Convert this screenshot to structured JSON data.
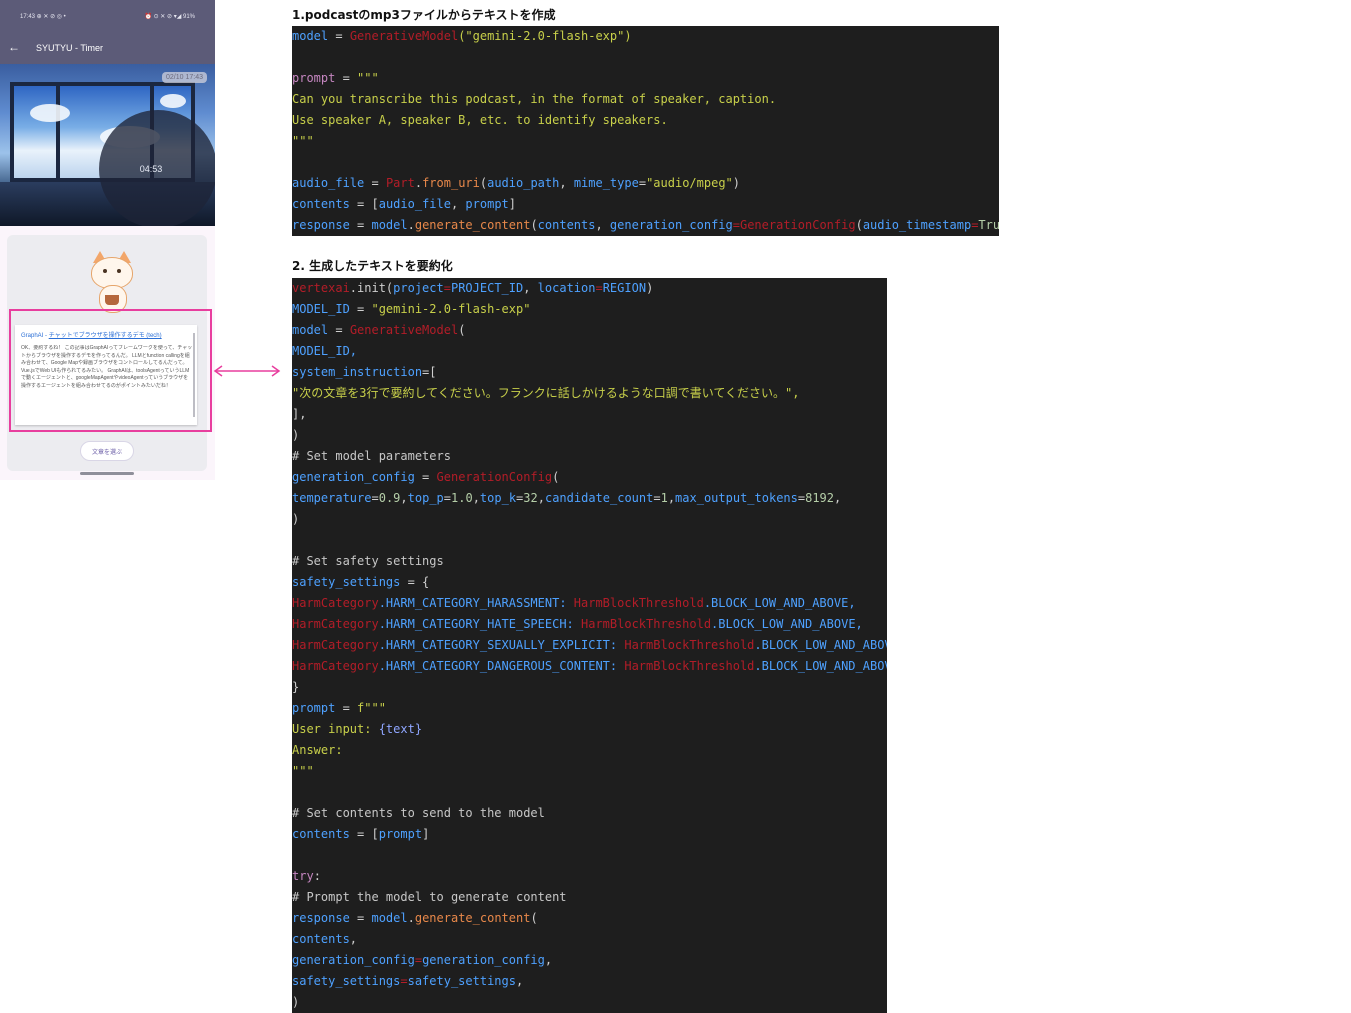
{
  "phone": {
    "status_left": "17:43 ⊕ ✕ ⊘ ◎ •",
    "status_right": "⏰ ⊙ ✕ ⊘ ▾◢ 91%",
    "app_title": "SYUTYU - Timer",
    "back_icon": "←",
    "timestamp_badge": "02/10 17:43",
    "timer": "04:53",
    "card_prefix": "GraphAI - ",
    "card_link": "チャットでブラウザを操作するデモ (tech)",
    "card_body": "OK、要約するね！ この記事はGraphAIってフレームワークを使って、チャットからブラウザを操作するデモを作ってるんだ。 LLMとfunction callingを組み合わせて、Google Mapや録画ブラウザをコントロールしてるんだって。Vue.jsでWeb UIも作られてるみたい。 GraphAIは、toolsAgentっていうLLMで動くエージェントと、googleMapAgentやvideoAgentっていうブラウザを操作するエージェントを組み合わせてるのがポイントみたいだね！",
    "pill_label": "文章を選ぶ"
  },
  "sections": [
    {
      "title": "1.podcastのmp3ファイルからテキストを作成"
    },
    {
      "title": "2. 生成したテキストを要約化"
    }
  ],
  "code1": {
    "l1": [
      "model",
      " = ",
      "GenerativeModel",
      "(\"gemini-2.0-flash-exp\")"
    ],
    "l3": [
      "prompt",
      " = ",
      "\"\"\""
    ],
    "l4": "Can you transcribe this podcast, in the format of speaker, caption.",
    "l5": "Use speaker A, speaker B, etc. to identify speakers.",
    "l6": "\"\"\"",
    "l8": [
      "audio_file",
      " = ",
      "Part",
      ".",
      "from_uri",
      "(",
      "audio_path",
      ", ",
      "mime_type",
      "=",
      "\"audio/mpeg\"",
      ")"
    ],
    "l9": [
      "contents",
      " = ",
      "[",
      "audio_file",
      ", ",
      "prompt",
      "]"
    ],
    "l10": [
      "response",
      " = ",
      "model",
      ".",
      "generate_content",
      "(",
      "contents",
      ", ",
      "generation_config",
      "=",
      "GenerationConfig",
      "(",
      "audio_timestamp",
      "=",
      "True",
      "))"
    ]
  },
  "code2": {
    "l1": [
      "vertexai",
      ".init(",
      "project",
      "=",
      "PROJECT_ID",
      ", ",
      "location",
      "=",
      "REGION",
      ")"
    ],
    "l2": [
      "MODEL_ID",
      " = ",
      "\"gemini-2.0-flash-exp\""
    ],
    "l3": [
      "model",
      " = ",
      "GenerativeModel",
      "("
    ],
    "l4": "MODEL_ID,",
    "l5": [
      "system_instruction",
      "=["
    ],
    "l6": "\"次の文章を3行で要約してください。フランクに話しかけるような口調で書いてください。\",",
    "l7": "],",
    "l8": ")",
    "l9": "# Set model parameters",
    "l10": [
      "generation_config",
      " = ",
      "GenerationConfig",
      "("
    ],
    "l11": [
      "temperature",
      "=",
      "0.9",
      ",",
      "top_p",
      "=",
      "1.0",
      ",",
      "top_k",
      "=",
      "32",
      ",",
      "candidate_count",
      "=",
      "1",
      ",",
      "max_output_tokens",
      "=",
      "8192",
      ","
    ],
    "l12": ")",
    "l14": "# Set safety settings",
    "l15": [
      "safety_settings",
      " = {"
    ],
    "l16": [
      "HarmCategory",
      ".HARM_CATEGORY_HARASSMENT: ",
      "HarmBlockThreshold",
      ".BLOCK_LOW_AND_ABOVE,"
    ],
    "l17": [
      "HarmCategory",
      ".HARM_CATEGORY_HATE_SPEECH: ",
      "HarmBlockThreshold",
      ".BLOCK_LOW_AND_ABOVE,"
    ],
    "l18": [
      "HarmCategory",
      ".HARM_CATEGORY_SEXUALLY_EXPLICIT: ",
      "HarmBlockThreshold",
      ".BLOCK_LOW_AND_ABOVE,"
    ],
    "l19": [
      "HarmCategory",
      ".HARM_CATEGORY_DANGEROUS_CONTENT: ",
      "HarmBlockThreshold",
      ".BLOCK_LOW_AND_ABOVE,"
    ],
    "l20": "}",
    "l21": [
      "prompt",
      " = ",
      "f\"\"\""
    ],
    "l22": [
      "User input: ",
      "{text}"
    ],
    "l23": "Answer:",
    "l24": "\"\"\"",
    "l26": "# Set contents to send to the model",
    "l27": [
      "contents",
      " = ",
      "[",
      "prompt",
      "]"
    ],
    "l29": [
      "try",
      ":"
    ],
    "l30": "# Prompt the model to generate content",
    "l31": [
      "response",
      " = ",
      "model",
      ".",
      "generate_content",
      "("
    ],
    "l32": [
      "contents",
      ","
    ],
    "l33": [
      "generation_config",
      "=",
      "generation_config",
      ","
    ],
    "l34": [
      "safety_settings",
      "=",
      "safety_settings",
      ","
    ],
    "l35": ")"
  },
  "colors": {
    "highlight": "#e83e9e",
    "code_bg": "#1e1e1e",
    "app_bar": "#5c5b78"
  }
}
